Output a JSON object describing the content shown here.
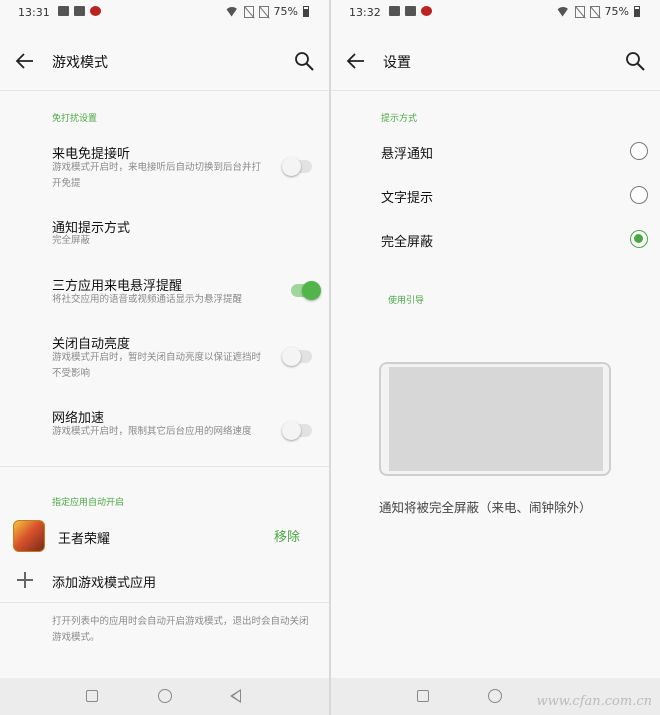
{
  "left": {
    "status": {
      "time": "13:31",
      "battery": "75%"
    },
    "appbar": {
      "title": "游戏模式"
    },
    "section1": {
      "label": "免打扰设置"
    },
    "settings": [
      {
        "title": "来电免提接听",
        "sub": "游戏模式开启时，来电接听后自动切换到后台并打开免提",
        "on": false
      },
      {
        "title": "通知提示方式",
        "sub": "完全屏蔽"
      },
      {
        "title": "三方应用来电悬浮提醒",
        "sub": "将社交应用的语音或视频通话显示为悬浮提醒",
        "on": true
      },
      {
        "title": "关闭自动亮度",
        "sub": "游戏模式开启时，暂时关闭自动亮度以保证遮挡时不受影响",
        "on": false
      },
      {
        "title": "网络加速",
        "sub": "游戏模式开启时，限制其它后台应用的网络速度",
        "on": false
      }
    ],
    "section2": {
      "label": "指定应用自动开启"
    },
    "app": {
      "name": "王者荣耀",
      "action": "移除"
    },
    "add": {
      "label": "添加游戏模式应用"
    },
    "footer": "打开列表中的应用时会自动开启游戏模式，退出时会自动关闭游戏模式。"
  },
  "right": {
    "status": {
      "time": "13:32",
      "battery": "75%"
    },
    "appbar": {
      "title": "设置"
    },
    "section": {
      "label": "提示方式"
    },
    "options": [
      {
        "label": "悬浮通知",
        "checked": false
      },
      {
        "label": "文字提示",
        "checked": false
      },
      {
        "label": "完全屏蔽",
        "checked": true
      }
    ],
    "guide": {
      "label": "使用引导"
    },
    "explain": "通知将被完全屏蔽（来电、闹钟除外）",
    "watermark": "www.cfan.com.cn"
  },
  "colors": {
    "accent": "#4aa843",
    "background": "#f8f8f8",
    "navbar": "#ececec"
  },
  "icons": [
    "back-arrow-icon",
    "search-icon",
    "plus-icon",
    "wifi-icon",
    "battery-icon",
    "nav-recents-icon",
    "nav-home-icon",
    "nav-back-icon"
  ]
}
